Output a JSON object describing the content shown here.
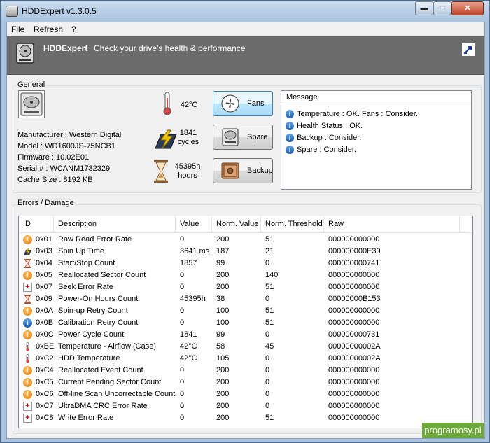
{
  "window": {
    "title": "HDDExpert v1.3.0.5",
    "minimize": "▬",
    "maximize": "□",
    "close": "✕"
  },
  "menu": [
    "File",
    "Refresh",
    "?"
  ],
  "banner": {
    "name": "HDDExpert",
    "slogan": "Check your drive's health & performance"
  },
  "general": {
    "label": "General",
    "manufacturer": "Manufacturer : Western Digital",
    "model": "Model : WD1600JS-75NCB1",
    "firmware": "Firmware : 10.02E01",
    "serial": "Serial # : WCANM1732329",
    "cache": "Cache Size : 8192 KB",
    "temperature": "42°C",
    "cycles_value": "1841",
    "cycles_unit": "cycles",
    "hours_value": "45395h",
    "hours_unit": "hours"
  },
  "buttons": {
    "fans": "Fans",
    "spare": "Spare",
    "backup": "Backup"
  },
  "messages": {
    "header": "Message",
    "items": [
      "Temperature : OK. Fans : Consider.",
      "Health Status : OK.",
      "Backup : Consider.",
      "Spare : Consider."
    ]
  },
  "errors": {
    "label": "Errors / Damage",
    "columns": [
      "ID",
      "Description",
      "Value",
      "Norm. Value",
      "Norm. Threshold",
      "Raw"
    ],
    "rows": [
      {
        "icon": "warning-icon",
        "id": "0x01",
        "desc": "Raw Read Error Rate",
        "value": "0",
        "norm": "200",
        "thr": "51",
        "raw": "000000000000"
      },
      {
        "icon": "lightning-icon",
        "id": "0x03",
        "desc": "Spin Up Time",
        "value": "3641 ms",
        "norm": "187",
        "thr": "21",
        "raw": "000000000E39"
      },
      {
        "icon": "hourglass-icon",
        "id": "0x04",
        "desc": "Start/Stop Count",
        "value": "1857",
        "norm": "99",
        "thr": "0",
        "raw": "000000000741"
      },
      {
        "icon": "warning-icon",
        "id": "0x05",
        "desc": "Reallocated Sector Count",
        "value": "0",
        "norm": "200",
        "thr": "140",
        "raw": "000000000000"
      },
      {
        "icon": "medical-cross-icon",
        "id": "0x07",
        "desc": "Seek Error Rate",
        "value": "0",
        "norm": "200",
        "thr": "51",
        "raw": "000000000000"
      },
      {
        "icon": "hourglass-icon",
        "id": "0x09",
        "desc": "Power-On Hours Count",
        "value": "45395h",
        "norm": "38",
        "thr": "0",
        "raw": "00000000B153"
      },
      {
        "icon": "warning-icon",
        "id": "0x0A",
        "desc": "Spin-up Retry Count",
        "value": "0",
        "norm": "100",
        "thr": "51",
        "raw": "000000000000"
      },
      {
        "icon": "info-icon",
        "id": "0x0B",
        "desc": "Calibration Retry Count",
        "value": "0",
        "norm": "100",
        "thr": "51",
        "raw": "000000000000"
      },
      {
        "icon": "warning-icon",
        "id": "0x0C",
        "desc": "Power Cycle Count",
        "value": "1841",
        "norm": "99",
        "thr": "0",
        "raw": "000000000731"
      },
      {
        "icon": "thermometer-icon",
        "id": "0xBE",
        "desc": "Temperature - Airflow (Case)",
        "value": "42°C",
        "norm": "58",
        "thr": "45",
        "raw": "00000000002A"
      },
      {
        "icon": "thermometer-icon",
        "id": "0xC2",
        "desc": "HDD Temperature",
        "value": "42°C",
        "norm": "105",
        "thr": "0",
        "raw": "00000000002A"
      },
      {
        "icon": "warning-icon",
        "id": "0xC4",
        "desc": "Reallocated Event Count",
        "value": "0",
        "norm": "200",
        "thr": "0",
        "raw": "000000000000"
      },
      {
        "icon": "warning-icon",
        "id": "0xC5",
        "desc": "Current Pending Sector Count",
        "value": "0",
        "norm": "200",
        "thr": "0",
        "raw": "000000000000"
      },
      {
        "icon": "warning-icon",
        "id": "0xC6",
        "desc": "Off-line Scan Uncorrectable Count",
        "value": "0",
        "norm": "200",
        "thr": "0",
        "raw": "000000000000"
      },
      {
        "icon": "medical-cross-icon",
        "id": "0xC7",
        "desc": "UltraDMA CRC Error Rate",
        "value": "0",
        "norm": "200",
        "thr": "0",
        "raw": "000000000000"
      },
      {
        "icon": "medical-cross-icon",
        "id": "0xC8",
        "desc": "Write Error Rate",
        "value": "0",
        "norm": "200",
        "thr": "51",
        "raw": "000000000000"
      }
    ]
  },
  "watermark": "programosy.pl"
}
